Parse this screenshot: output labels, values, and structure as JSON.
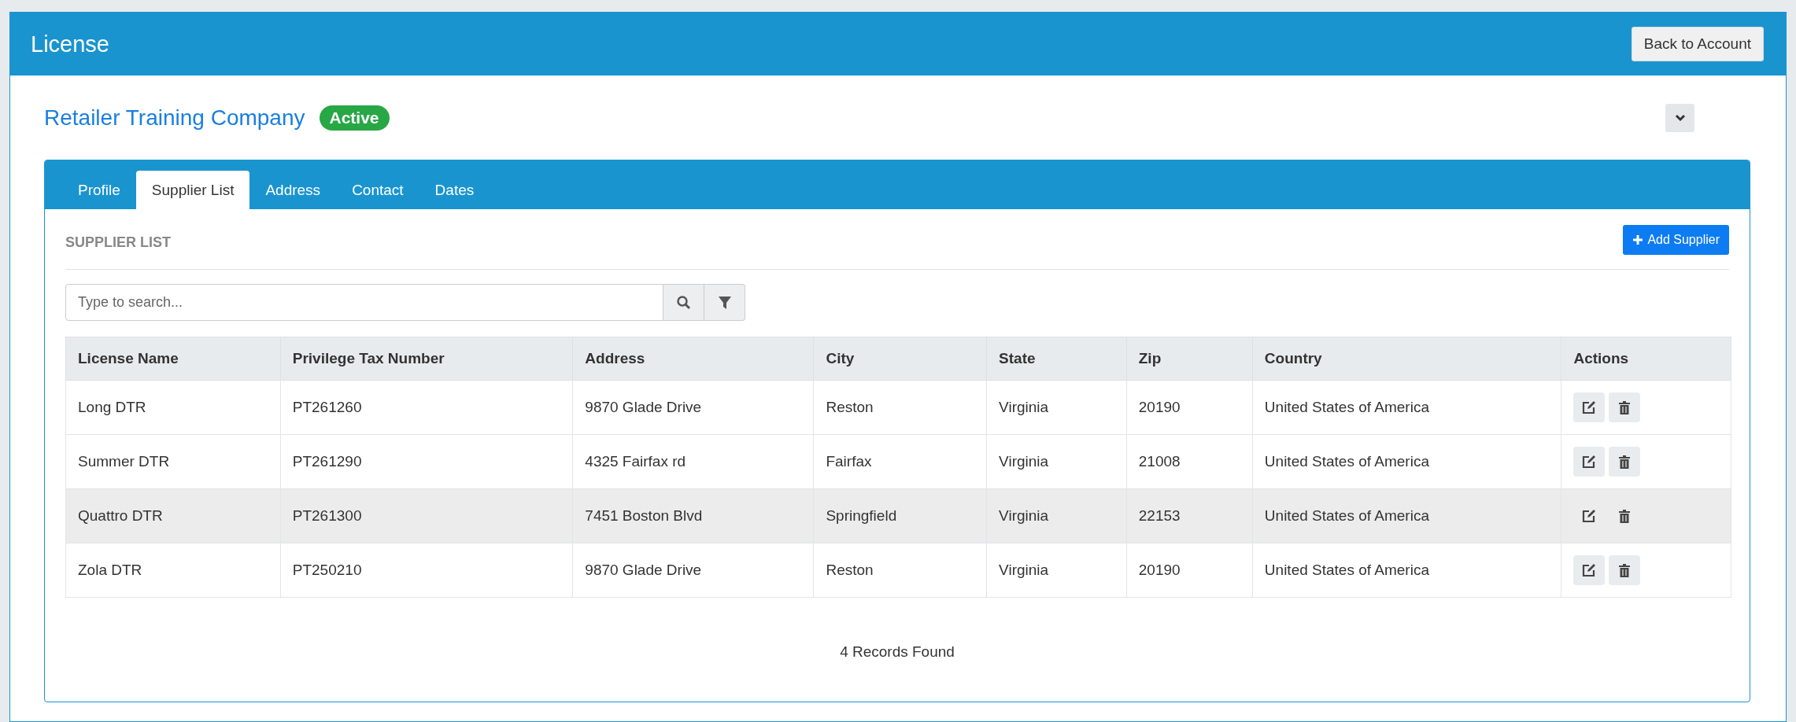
{
  "header": {
    "title": "License",
    "back_button": "Back to Account"
  },
  "company": {
    "name": "Retailer Training Company",
    "status": "Active",
    "expanded": false
  },
  "tabs": [
    {
      "label": "Profile",
      "selected": false
    },
    {
      "label": "Supplier List",
      "selected": true
    },
    {
      "label": "Address",
      "selected": false
    },
    {
      "label": "Contact",
      "selected": false
    },
    {
      "label": "Dates",
      "selected": false
    }
  ],
  "section": {
    "title": "SUPPLIER LIST",
    "add_button": "Add Supplier"
  },
  "search": {
    "placeholder": "Type to search..."
  },
  "table": {
    "columns": [
      "License Name",
      "Privilege Tax Number",
      "Address",
      "City",
      "State",
      "Zip",
      "Country",
      "Actions"
    ],
    "rows": [
      {
        "selected": false,
        "cells": [
          "Long DTR",
          "PT261260",
          "9870 Glade Drive",
          "Reston",
          "Virginia",
          "20190",
          "United States of America"
        ]
      },
      {
        "selected": false,
        "cells": [
          "Summer DTR",
          "PT261290",
          "4325 Fairfax rd",
          "Fairfax",
          "Virginia",
          "21008",
          "United States of America"
        ]
      },
      {
        "selected": true,
        "cells": [
          "Quattro DTR",
          "PT261300",
          "7451 Boston Blvd",
          "Springfield",
          "Virginia",
          "22153",
          "United States of America"
        ]
      },
      {
        "selected": false,
        "cells": [
          "Zola DTR",
          "PT250210",
          "9870 Glade Drive",
          "Reston",
          "Virginia",
          "20190",
          "United States of America"
        ]
      }
    ]
  },
  "footer": {
    "records": "4 Records Found"
  }
}
